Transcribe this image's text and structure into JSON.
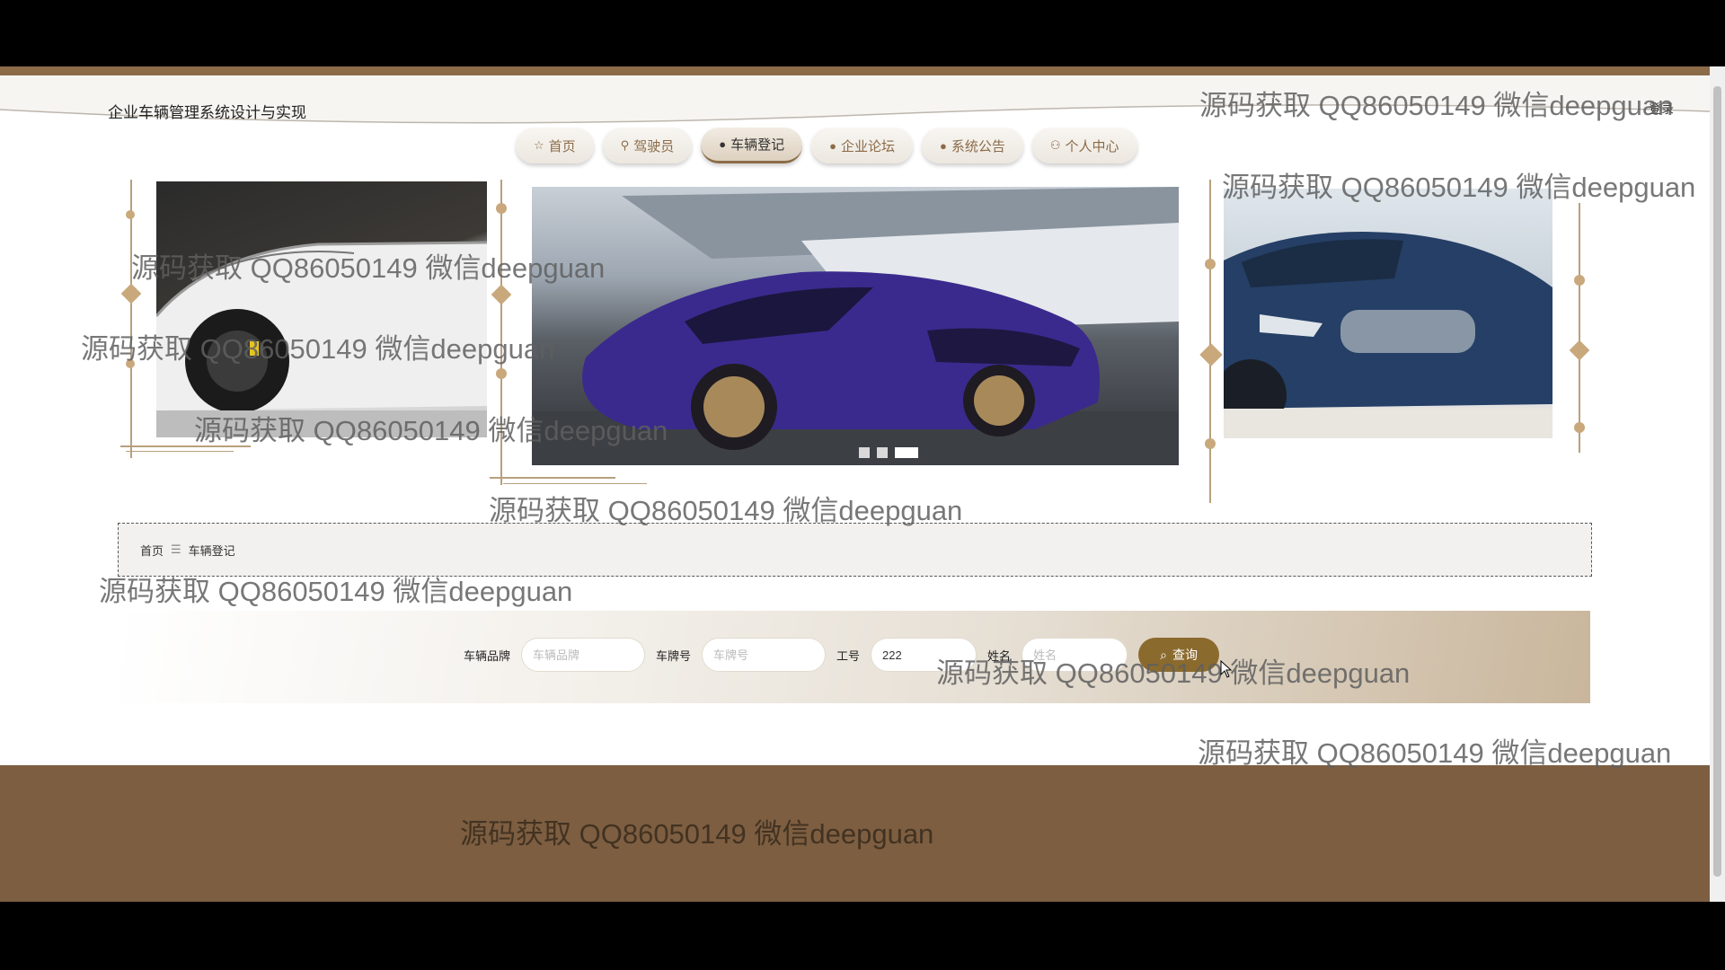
{
  "header": {
    "site_title": "企业车辆管理系统设计与实现",
    "login": "登录"
  },
  "nav": [
    {
      "label": "首页",
      "icon": "☆"
    },
    {
      "label": "驾驶员",
      "icon": "⚲"
    },
    {
      "label": "车辆登记",
      "icon": "●"
    },
    {
      "label": "企业论坛",
      "icon": "●"
    },
    {
      "label": "系统公告",
      "icon": "●"
    },
    {
      "label": "个人中心",
      "icon": "⚇"
    }
  ],
  "breadcrumb": {
    "home": "首页",
    "separator": "☰",
    "current": "车辆登记"
  },
  "search": {
    "brand_label": "车辆品牌",
    "brand_placeholder": "车辆品牌",
    "plate_label": "车牌号",
    "plate_placeholder": "车牌号",
    "worknum_label": "工号",
    "worknum_value": "222",
    "name_label": "姓名",
    "name_placeholder": "姓名",
    "button_label": "查询"
  },
  "watermark_text": "源码获取 QQ86050149 微信deepguan",
  "colors": {
    "accent": "#8b6b48",
    "footer": "#7d5e41",
    "button": "#8b6a2e"
  }
}
